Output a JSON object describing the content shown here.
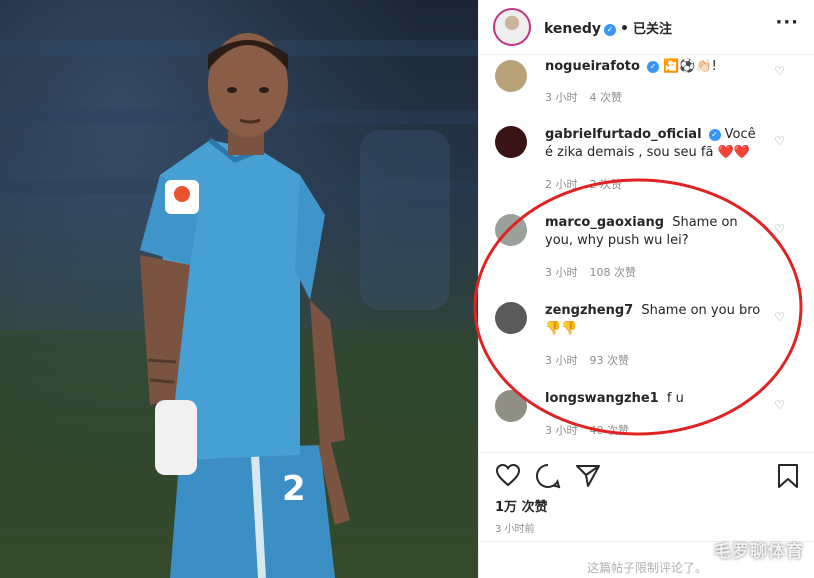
{
  "header": {
    "username": "kenedy",
    "verified_icon": "verified-badge-icon",
    "separator": "•",
    "follow_status": "已关注",
    "more_icon": "more-options-icon"
  },
  "comments": [
    {
      "user": "nogueirafoto",
      "text": "🎦⚽👏🏻!",
      "time": "3 小时",
      "likes": "4 次赞",
      "verified": true,
      "avatar_color": "#b8a27a"
    },
    {
      "user": "gabrielfurtado_oficial",
      "text": "Você é zika demais , sou seu fã ❤️❤️",
      "time": "2 小时",
      "likes": "2 次赞",
      "verified": true,
      "avatar_color": "#3a1414"
    },
    {
      "user": "marco_gaoxiang",
      "text": "Shame on you, why push wu lei?",
      "time": "3 小时",
      "likes": "108 次赞",
      "verified": false,
      "avatar_color": "#9aa19a"
    },
    {
      "user": "zengzheng7",
      "text": "Shame on you bro 👎👎",
      "time": "3 小时",
      "likes": "93 次赞",
      "verified": false,
      "avatar_color": "#5a5a5a"
    },
    {
      "user": "longswangzhe1",
      "text": "f u",
      "time": "3 小时",
      "likes": "40 次赞",
      "verified": false,
      "avatar_color": "#8f8f84"
    }
  ],
  "post": {
    "likes": "1万 次赞",
    "time": "3 小时前",
    "comments_restricted": "这篇帖子限制评论了。"
  },
  "watermark": "毛罗聊体育",
  "colors": {
    "annotation_red": "#e02424",
    "jersey_blue": "#3f95c9",
    "verified_blue": "#3897f0"
  }
}
